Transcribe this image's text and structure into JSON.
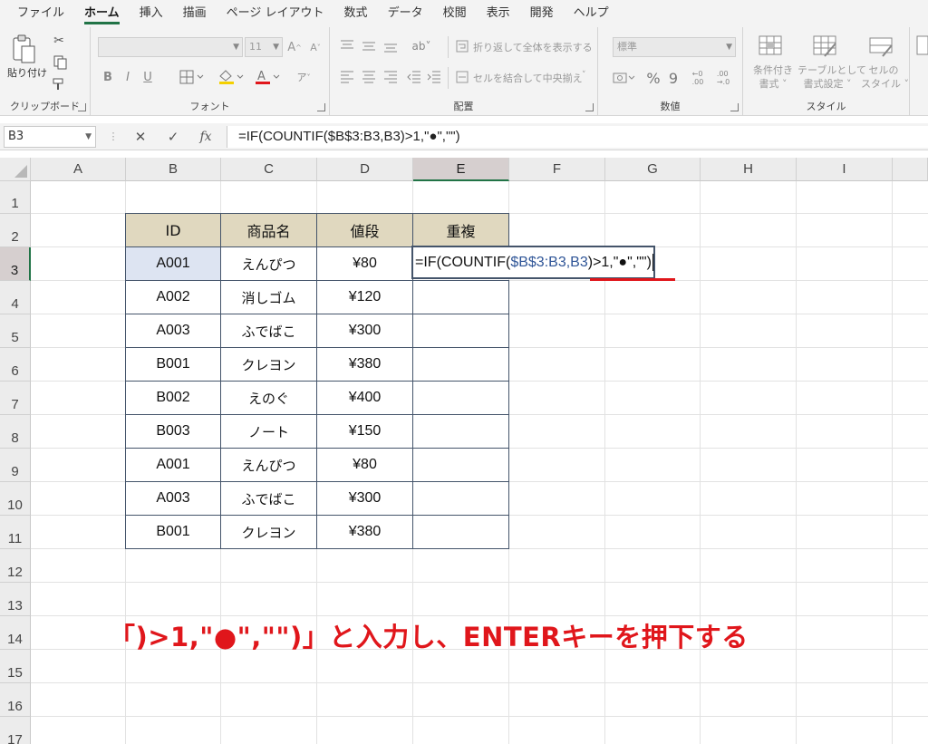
{
  "ribbon": {
    "tabs": [
      "ファイル",
      "ホーム",
      "挿入",
      "描画",
      "ページ レイアウト",
      "数式",
      "データ",
      "校閲",
      "表示",
      "開発",
      "ヘルプ"
    ],
    "active_tab": "ホーム",
    "clipboard": {
      "paste_label": "貼り付け",
      "group_label": "クリップボード"
    },
    "font": {
      "size_value": "11",
      "bold": "B",
      "italic": "I",
      "underline": "U",
      "group_label": "フォント"
    },
    "alignment": {
      "wrap_text": "折り返して全体を表示する",
      "merge_center": "セルを結合して中央揃え",
      "group_label": "配置"
    },
    "number": {
      "format_value": "標準",
      "percent": "%",
      "comma": "9",
      "group_label": "数値"
    },
    "styles": {
      "conditional": [
        "条件付き",
        "書式 ˅"
      ],
      "table": [
        "テーブルとして",
        "書式設定 ˅"
      ],
      "cell": [
        "セルの",
        "スタイル ˅"
      ],
      "group_label": "スタイル"
    },
    "accent_color": "#217346"
  },
  "formula_bar": {
    "name_box": "B3",
    "cancel_icon": "✕",
    "enter_icon": "✓",
    "fx_label": "fx",
    "formula": "=IF(COUNTIF($B$3:B3,B3)>1,\"●\",\"\")"
  },
  "sheet": {
    "columns": [
      "A",
      "B",
      "C",
      "D",
      "E",
      "F",
      "G",
      "H",
      "I"
    ],
    "selected_column": "E",
    "rows": [
      "1",
      "2",
      "3",
      "4",
      "5",
      "6",
      "7",
      "8",
      "9",
      "10",
      "11",
      "12",
      "13",
      "14",
      "15",
      "16",
      "17"
    ],
    "selected_row": "3",
    "table": {
      "headers": [
        "ID",
        "商品名",
        "値段",
        "重複"
      ],
      "rows": [
        [
          "A001",
          "えんぴつ",
          "¥80"
        ],
        [
          "A002",
          "消しゴム",
          "¥120"
        ],
        [
          "A003",
          "ふでばこ",
          "¥300"
        ],
        [
          "B001",
          "クレヨン",
          "¥380"
        ],
        [
          "B002",
          "えのぐ",
          "¥400"
        ],
        [
          "B003",
          "ノート",
          "¥150"
        ],
        [
          "A001",
          "えんぴつ",
          "¥80"
        ],
        [
          "A003",
          "ふでばこ",
          "¥300"
        ],
        [
          "B001",
          "クレヨン",
          "¥380"
        ]
      ]
    },
    "editing_cell": {
      "part1": "=IF(COUNTIF(",
      "part2": "$B$3:B3,B3",
      "part3": ")>1,\"●\",\"\")"
    },
    "header_fill": "#e0d8bf",
    "selection_fill": "#dde4f2"
  },
  "annotation": {
    "text": "「)>1,\"●\",\"\")」と入力し、ENTERキーを押下する",
    "color": "#e0161b"
  }
}
